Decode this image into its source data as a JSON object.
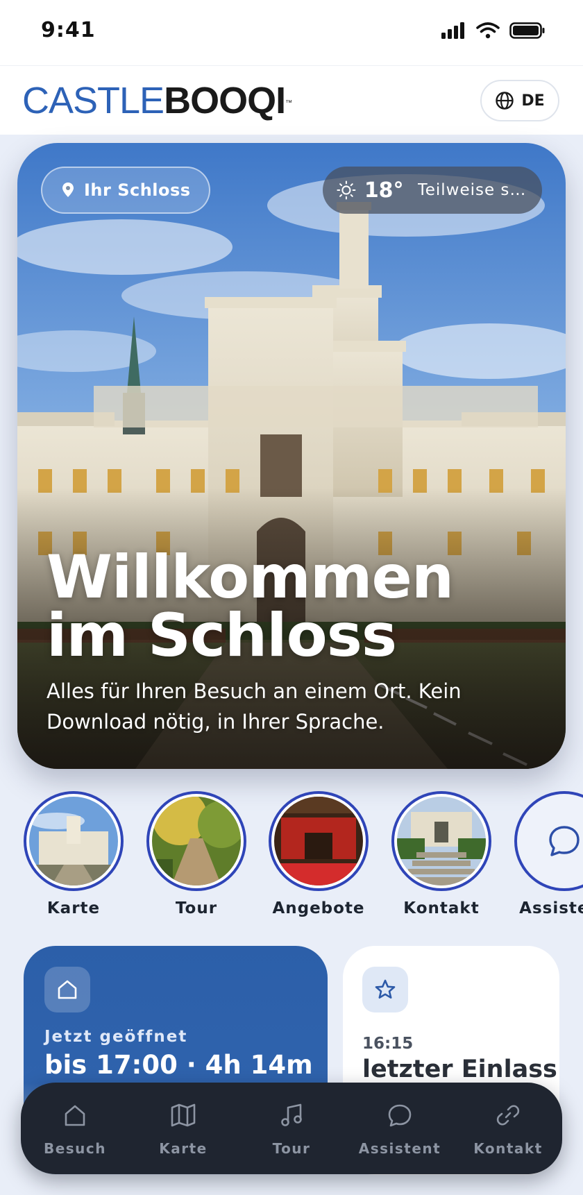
{
  "status_bar": {
    "time": "9:41",
    "icons": [
      "signal-icon",
      "wifi-icon",
      "battery-icon"
    ]
  },
  "header": {
    "logo_part1": "CASTLE",
    "logo_part2": "BOOQI",
    "logo_tm": "™",
    "language_label": "DE"
  },
  "hero": {
    "location_label": "Ihr Schloss",
    "weather_temp": "18°",
    "weather_condition": "Teilweise so…",
    "title_line1": "Willkommen",
    "title_line2": "im Schloss",
    "subtitle": "Alles für Ihren Besuch an einem Ort. Kein Download nötig, in Ihrer Sprache."
  },
  "stories": [
    {
      "label": "Karte"
    },
    {
      "label": "Tour"
    },
    {
      "label": "Angebote"
    },
    {
      "label": "Kontakt"
    },
    {
      "label": "Assistent"
    }
  ],
  "cards": {
    "open": {
      "kicker": "Jetzt geöffnet",
      "value": "bis 17:00 · 4h 14m"
    },
    "entry": {
      "kicker": "16:15",
      "value": "letzter Einlass"
    }
  },
  "tabbar": [
    {
      "label": "Besuch",
      "icon": "home-icon"
    },
    {
      "label": "Karte",
      "icon": "map-icon"
    },
    {
      "label": "Tour",
      "icon": "music-icon"
    },
    {
      "label": "Assistent",
      "icon": "chat-icon"
    },
    {
      "label": "Kontakt",
      "icon": "link-icon"
    }
  ],
  "colors": {
    "brand_blue": "#2d62b7",
    "ring": "#2f45b8",
    "tabbar_bg": "#1f2530"
  }
}
